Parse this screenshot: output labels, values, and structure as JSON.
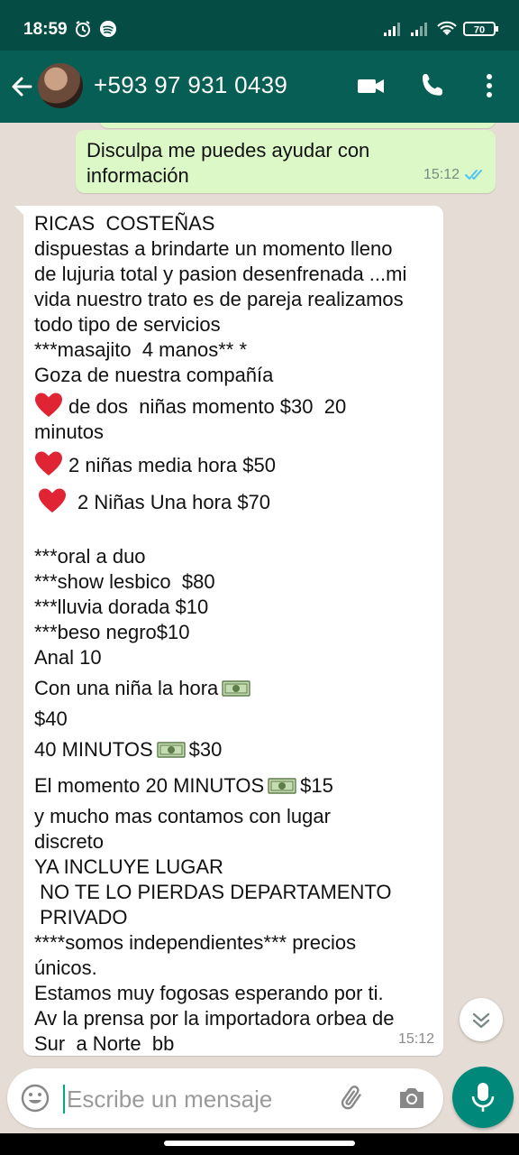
{
  "status_bar": {
    "time": "18:59",
    "battery": "70"
  },
  "header": {
    "contact": "+593 97 931 0439"
  },
  "messages": {
    "outgoing": {
      "text": "Disculpa me puedes ayudar con\ninformación",
      "time": "15:12"
    },
    "incoming": {
      "lines": [
        "RICAS  COSTEÑAS",
        "dispuestas a brindarte un momento lleno",
        "de lujuria total y pasion desenfrenada ...mi",
        "vida nuestro trato es de pareja realizamos",
        "todo tipo de servicios",
        "***masajito  4 manos** *",
        "Goza de nuestra compañía",
        "de dos  niñas momento $30  20",
        "minutos",
        "2 niñas media hora $50",
        "2 Niñas Una hora $70",
        "***oral a duo",
        "***show lesbico  $80",
        "***lluvia dorada $10",
        "***beso negro$10",
        "Anal 10",
        "Con una niña la hora",
        "$40",
        "40 MINUTOS",
        "$30",
        "El momento 20 MINUTOS",
        "$15",
        "y mucho mas contamos con lugar",
        "discreto",
        "YA INCLUYE LUGAR",
        " NO TE LO PIERDAS DEPARTAMENTO",
        " PRIVADO",
        "****somos independientes*** precios",
        "únicos.",
        "Estamos muy fogosas esperando por ti.",
        "Av la prensa por la importadora orbea de",
        "Sur  a Norte  bb"
      ],
      "time": "15:12"
    }
  },
  "input": {
    "placeholder": "Escribe un mensaje"
  },
  "colors": {
    "header": "#075e54",
    "status_bar": "#054d44",
    "outgoing_bubble": "#dcf8c6",
    "chat_bg": "#e5ddd5",
    "accent": "#00897b",
    "read_ticks": "#4fc3f7"
  },
  "icons": [
    "alarm-icon",
    "spotify-icon",
    "signal-icon",
    "wifi-icon",
    "battery-icon",
    "back-arrow-icon",
    "video-call-icon",
    "phone-icon",
    "more-options-icon",
    "read-receipt-icon",
    "heart-emoji-icon",
    "money-emoji-icon",
    "scroll-down-icon",
    "emoji-icon",
    "attach-icon",
    "camera-icon",
    "mic-icon"
  ]
}
